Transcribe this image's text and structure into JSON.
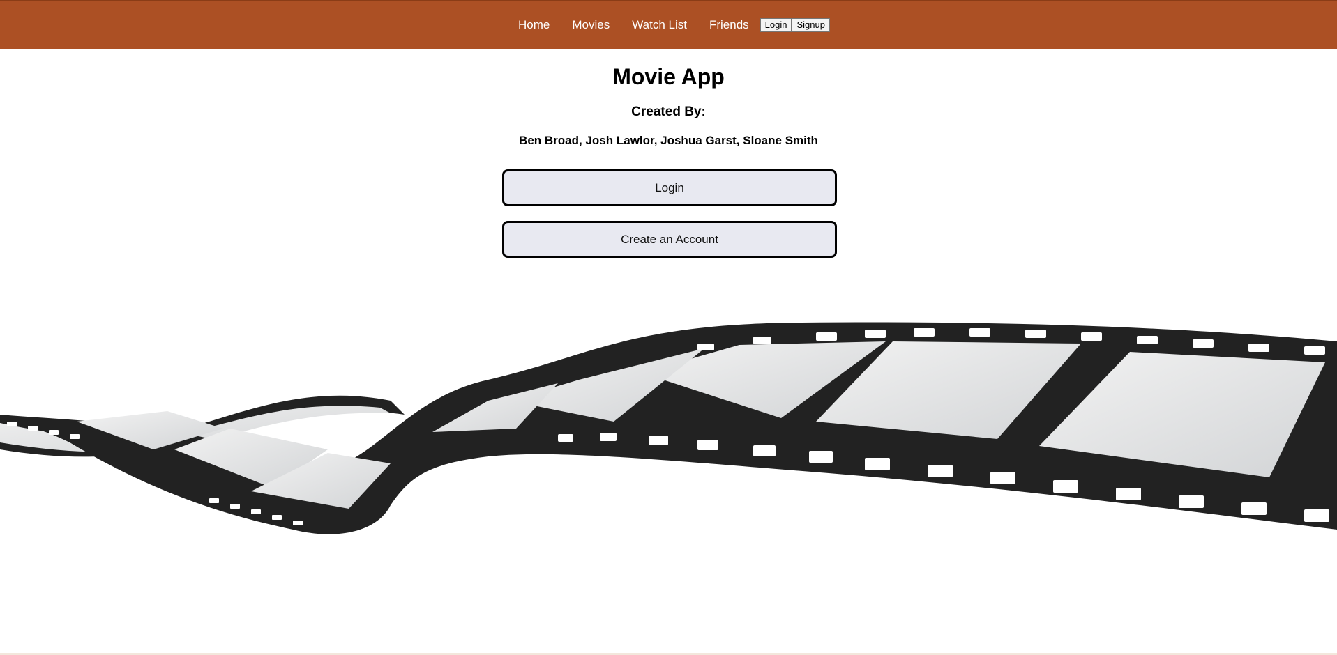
{
  "nav": {
    "links": [
      "Home",
      "Movies",
      "Watch List",
      "Friends"
    ],
    "login_button": "Login",
    "signup_button": "Signup",
    "bg_color": "#ac5024"
  },
  "main": {
    "title": "Movie App",
    "subtitle": "Created By:",
    "authors": "Ben Broad, Josh Lawlor, Joshua Garst, Sloane Smith",
    "login_button": "Login",
    "create_account_button": "Create an Account"
  },
  "decoration": {
    "image": "film-strip-illustration"
  }
}
